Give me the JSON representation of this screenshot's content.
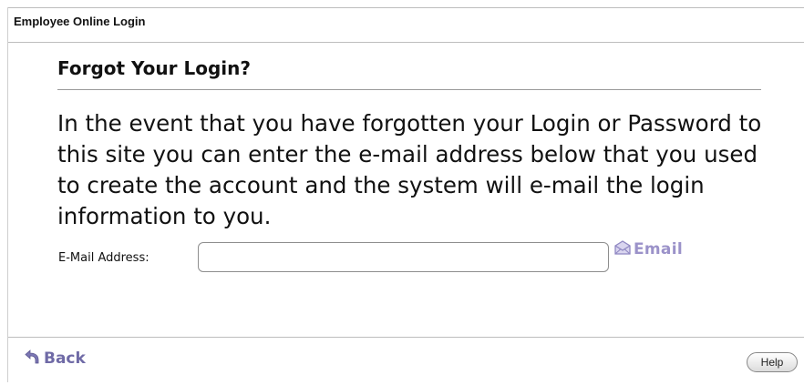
{
  "window": {
    "title": "Employee Online Login"
  },
  "page": {
    "heading": "Forgot Your Login?",
    "instructions": "In the event that you have forgotten your Login or Password to this site you can enter the e-mail address below that you used to create the account and the system will e-mail the login information to you."
  },
  "form": {
    "email_label": "E-Mail Address:",
    "email_value": "",
    "email_button_label": "Email",
    "email_button_icon": "envelope-icon"
  },
  "footer": {
    "back_label": "Back",
    "back_icon": "back-arrow-icon",
    "help_label": "Help"
  },
  "colors": {
    "accent_light": "#9b92c9",
    "accent_dark": "#6f6aa6"
  }
}
